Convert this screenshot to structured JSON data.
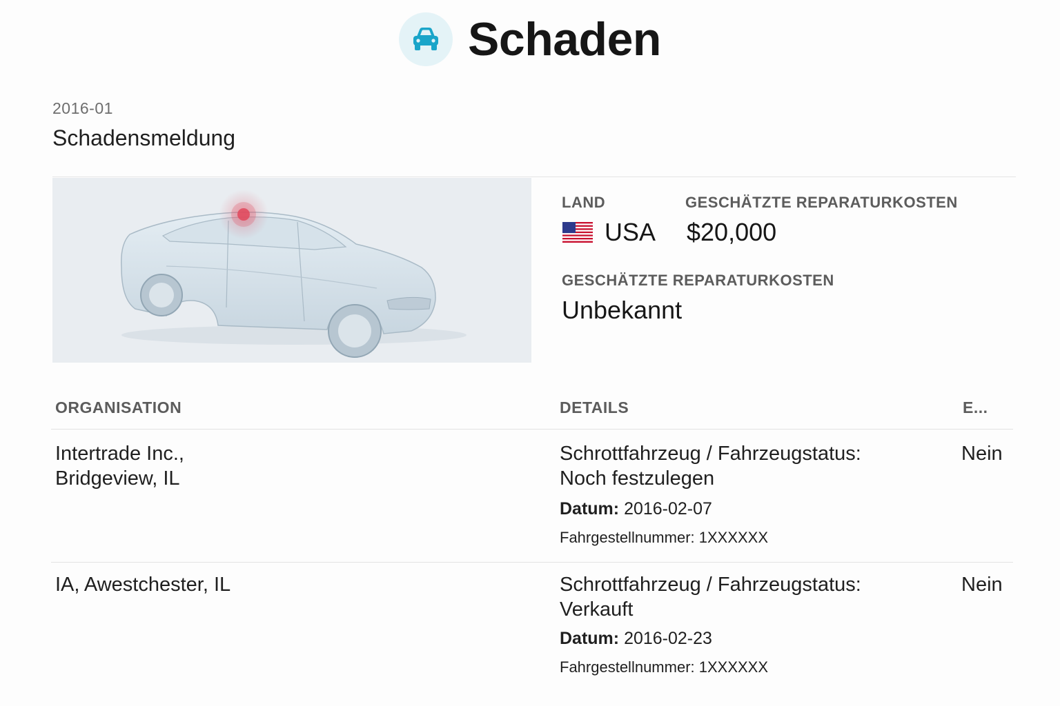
{
  "header": {
    "title": "Schaden",
    "icon": "car-icon",
    "icon_color": "#1aa5c9"
  },
  "record": {
    "date": "2016-01",
    "title": "Schadensmeldung"
  },
  "info": {
    "country_label": "LAND",
    "country_value": "USA",
    "cost_label": "GESCHÄTZTE REPARATURKOSTEN",
    "cost_value": "$20,000",
    "cost2_label": "GESCHÄTZTE REPARATURKOSTEN",
    "cost2_value": "Unbekannt"
  },
  "table": {
    "headers": [
      "ORGANISATION",
      "DETAILS",
      "E..."
    ],
    "rows": [
      {
        "org_line1": "Intertrade Inc.,",
        "org_line2": "Bridgeview, IL",
        "status_line1": "Schrottfahrzeug / Fahrzeugstatus:",
        "status_line2": "Noch festzulegen",
        "date_label": "Datum:",
        "date_value": "2016-02-07",
        "vin": "Fahrgestellnummer: 1XXXXXX",
        "e": "Nein"
      },
      {
        "org_line1": "IA, Awestchester, IL",
        "org_line2": "",
        "status_line1": "Schrottfahrzeug / Fahrzeugstatus:",
        "status_line2": "Verkauft",
        "date_label": "Datum:",
        "date_value": "2016-02-23",
        "vin": "Fahrgestellnummer: 1XXXXXX",
        "e": "Nein"
      }
    ]
  },
  "colors": {
    "damage_marker": "#e0485c",
    "accent": "#1aa5c9"
  }
}
